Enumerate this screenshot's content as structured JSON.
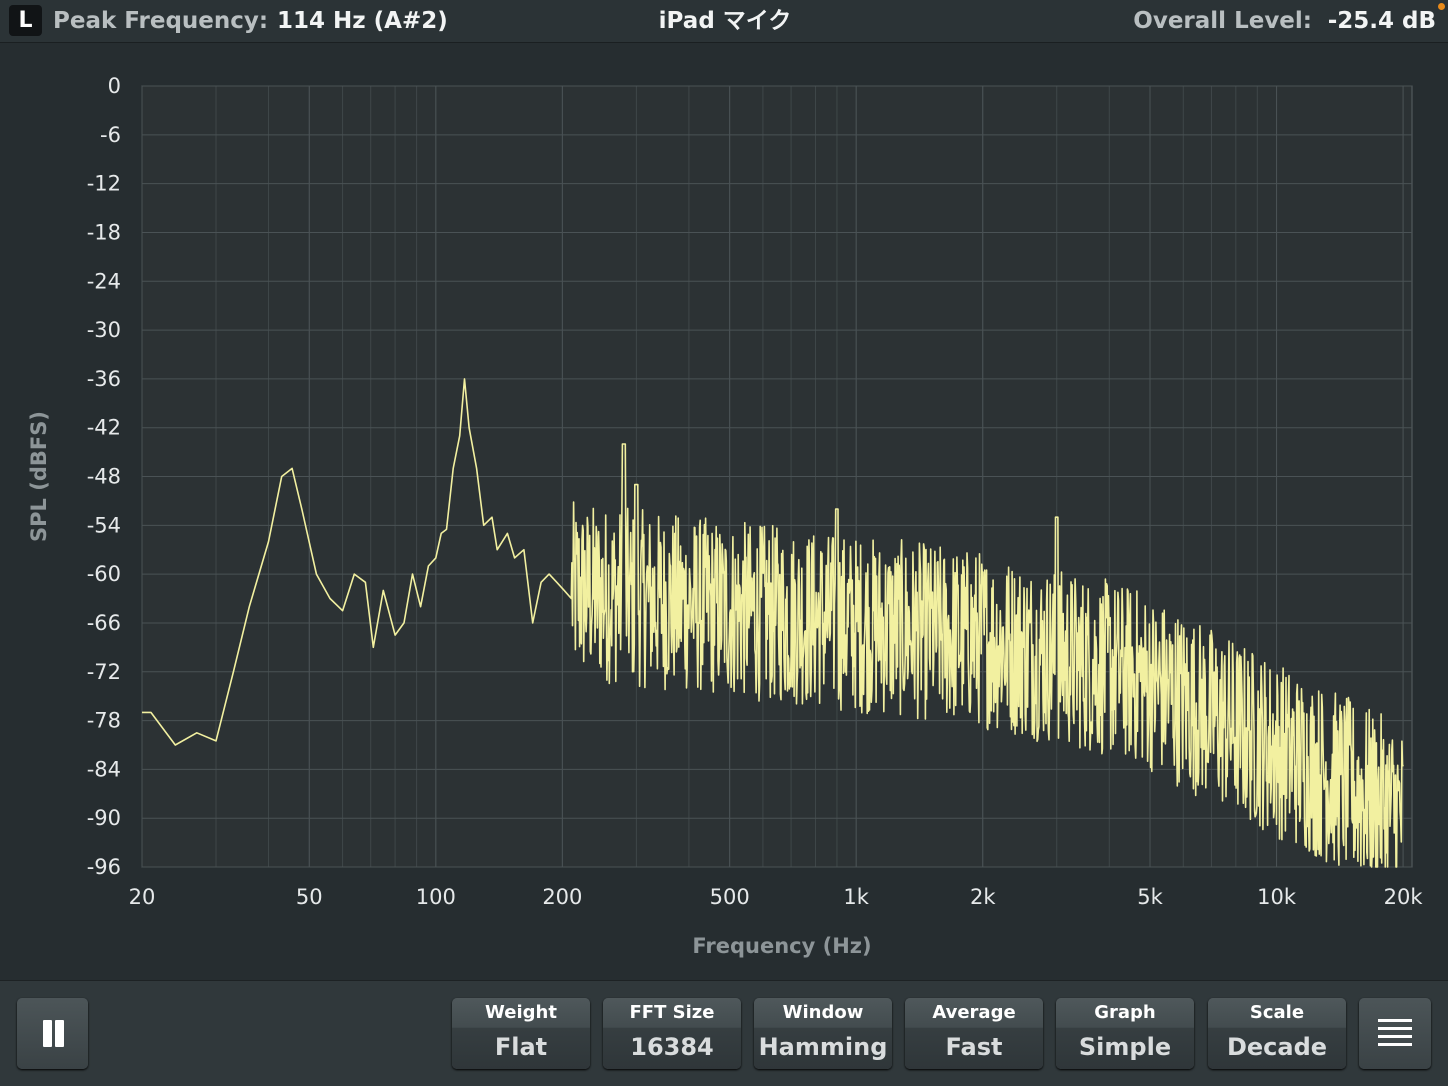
{
  "header": {
    "channel": "L",
    "peak_label": "Peak Frequency:",
    "peak_value": "114 Hz (A#2)",
    "device": "iPad マイク",
    "level_label": "Overall Level:",
    "level_value": "-25.4 dB"
  },
  "chart_data": {
    "type": "line",
    "xlabel": "Frequency (Hz)",
    "ylabel": "SPL (dBFS)",
    "x_scale": "log",
    "xlim": [
      20,
      21000
    ],
    "ylim": [
      -96,
      0
    ],
    "grid": true,
    "line_color": "#f2f0a0",
    "x_ticks": [
      {
        "value": 20,
        "label": "20"
      },
      {
        "value": 50,
        "label": "50"
      },
      {
        "value": 100,
        "label": "100"
      },
      {
        "value": 200,
        "label": "200"
      },
      {
        "value": 500,
        "label": "500"
      },
      {
        "value": 1000,
        "label": "1k"
      },
      {
        "value": 2000,
        "label": "2k"
      },
      {
        "value": 5000,
        "label": "5k"
      },
      {
        "value": 10000,
        "label": "10k"
      },
      {
        "value": 20000,
        "label": "20k"
      }
    ],
    "y_ticks": [
      0,
      -6,
      -12,
      -18,
      -24,
      -30,
      -36,
      -42,
      -48,
      -54,
      -60,
      -66,
      -72,
      -78,
      -84,
      -90,
      -96
    ],
    "series": [
      {
        "points": [
          [
            20,
            -77
          ],
          [
            21,
            -77
          ],
          [
            24,
            -81
          ],
          [
            27,
            -79.5
          ],
          [
            30,
            -80.5
          ],
          [
            33,
            -72
          ],
          [
            36,
            -64
          ],
          [
            40,
            -56
          ],
          [
            43,
            -48
          ],
          [
            45.5,
            -47
          ],
          [
            48,
            -52
          ],
          [
            52,
            -60
          ],
          [
            56,
            -63
          ],
          [
            60,
            -64.5
          ],
          [
            64,
            -60
          ],
          [
            68,
            -61
          ],
          [
            71,
            -69
          ],
          [
            75,
            -62
          ],
          [
            80,
            -67.5
          ],
          [
            84,
            -66
          ],
          [
            88,
            -60
          ],
          [
            92,
            -64
          ],
          [
            96,
            -59
          ],
          [
            100,
            -58
          ],
          [
            103,
            -55
          ],
          [
            106,
            -54.5
          ],
          [
            110,
            -47
          ],
          [
            114,
            -43
          ],
          [
            117,
            -36
          ],
          [
            120,
            -42
          ],
          [
            125,
            -47
          ],
          [
            130,
            -54
          ],
          [
            136,
            -53
          ],
          [
            140,
            -57
          ],
          [
            148,
            -55
          ],
          [
            154,
            -58
          ],
          [
            162,
            -57
          ],
          [
            170,
            -66
          ],
          [
            178,
            -61
          ],
          [
            186,
            -60
          ],
          [
            194,
            -61
          ],
          [
            202,
            -62
          ],
          [
            210,
            -63
          ]
        ]
      }
    ]
  },
  "toolbar": {
    "settings": [
      {
        "label": "Weight",
        "value": "Flat"
      },
      {
        "label": "FFT Size",
        "value": "16384"
      },
      {
        "label": "Window",
        "value": "Hamming"
      },
      {
        "label": "Average",
        "value": "Fast"
      },
      {
        "label": "Graph",
        "value": "Simple"
      },
      {
        "label": "Scale",
        "value": "Decade"
      }
    ]
  },
  "colors": {
    "background": "#262d30",
    "plot_background": "#2c3234",
    "grid": "#4a5255",
    "spectrum": "#f2f0a0",
    "accent": "#e88a1a"
  },
  "icons": {
    "pause": "pause-icon",
    "menu": "hamburger-menu-icon"
  }
}
